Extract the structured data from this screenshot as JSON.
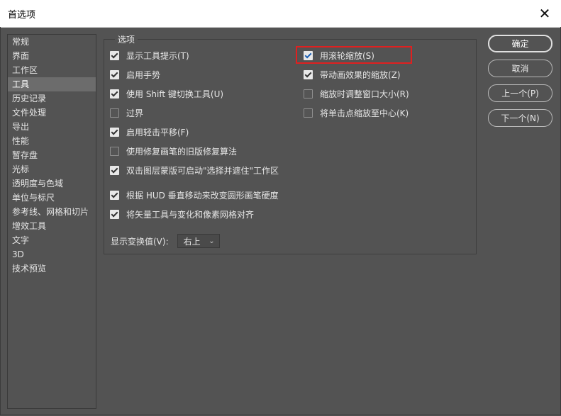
{
  "window": {
    "title": "首选项",
    "close_glyph": "✕"
  },
  "sidebar": {
    "items": [
      {
        "label": "常规"
      },
      {
        "label": "界面"
      },
      {
        "label": "工作区"
      },
      {
        "label": "工具",
        "selected": true
      },
      {
        "label": "历史记录"
      },
      {
        "label": "文件处理"
      },
      {
        "label": "导出"
      },
      {
        "label": "性能"
      },
      {
        "label": "暂存盘"
      },
      {
        "label": "光标"
      },
      {
        "label": "透明度与色域"
      },
      {
        "label": "单位与标尺"
      },
      {
        "label": "参考线、网格和切片"
      },
      {
        "label": "增效工具"
      },
      {
        "label": "文字"
      },
      {
        "label": "3D"
      },
      {
        "label": "技术预览"
      }
    ]
  },
  "options": {
    "legend": "选项",
    "left": [
      {
        "label": "显示工具提示(T)",
        "checked": true
      },
      {
        "label": "启用手势",
        "checked": true
      },
      {
        "label": "使用 Shift 键切换工具(U)",
        "checked": true
      },
      {
        "label": "过界",
        "checked": false
      },
      {
        "label": "启用轻击平移(F)",
        "checked": true
      },
      {
        "label": "使用修复画笔的旧版修复算法",
        "checked": false
      },
      {
        "label": "双击图层蒙版可启动\"选择并遮住\"工作区",
        "checked": true
      },
      {
        "label": "根据 HUD 垂直移动来改变圆形画笔硬度",
        "checked": true
      },
      {
        "label": "将矢量工具与变化和像素网格对齐",
        "checked": true
      }
    ],
    "right": [
      {
        "label": "用滚轮缩放(S)",
        "checked": true
      },
      {
        "label": "带动画效果的缩放(Z)",
        "checked": true
      },
      {
        "label": "缩放时调整窗口大小(R)",
        "checked": false
      },
      {
        "label": "将单击点缩放至中心(K)",
        "checked": false
      }
    ],
    "transform_values": {
      "label": "显示变换值(V):",
      "value": "右上"
    }
  },
  "buttons": {
    "ok": "确定",
    "cancel": "取消",
    "prev": "上一个(P)",
    "next": "下一个(N)"
  },
  "highlight_color": "#e02020"
}
